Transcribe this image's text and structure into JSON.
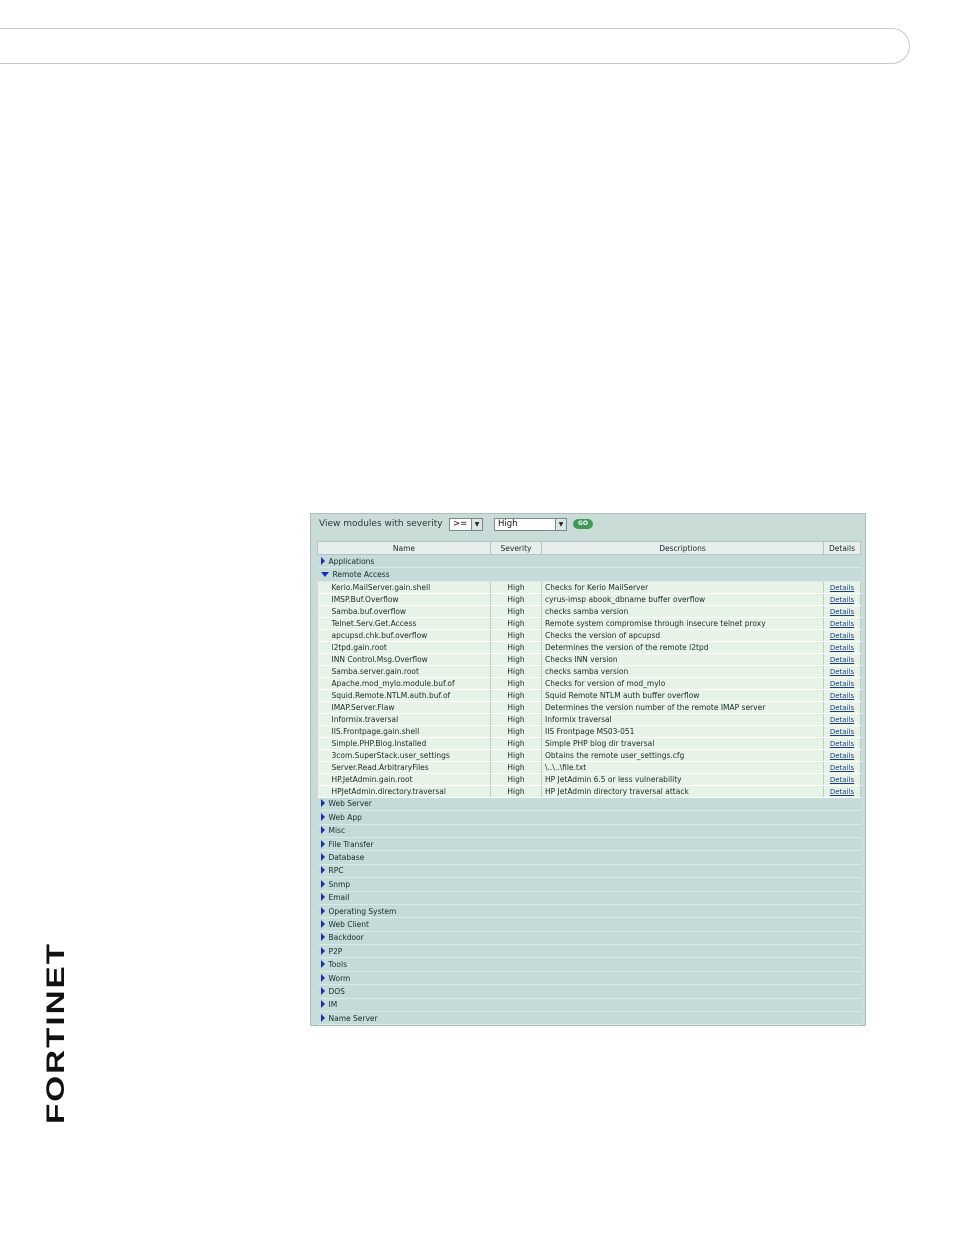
{
  "brand": {
    "logo_text": "FORTINET",
    "accent": "#d4202a"
  },
  "filter": {
    "label": "View modules with severity",
    "operator": ">=",
    "severity": "High",
    "go_label": "GO"
  },
  "table": {
    "headers": {
      "name": "Name",
      "severity": "Severity",
      "description": "Descriptions",
      "details": "Details"
    },
    "categories_before": [
      "Applications"
    ],
    "expanded_category": "Remote Access",
    "modules": [
      {
        "name": "Kerio.MailServer.gain.shell",
        "severity": "High",
        "description": "Checks for Kerio MailServer",
        "details": "Details"
      },
      {
        "name": "IMSP.Buf.Overflow",
        "severity": "High",
        "description": "cyrus-imsp abook_dbname buffer overflow",
        "details": "Details"
      },
      {
        "name": "Samba.buf.overflow",
        "severity": "High",
        "description": "checks samba version",
        "details": "Details"
      },
      {
        "name": "Telnet.Serv.Get.Access",
        "severity": "High",
        "description": "Remote system compromise through insecure telnet proxy",
        "details": "Details"
      },
      {
        "name": "apcupsd.chk.buf.overflow",
        "severity": "High",
        "description": "Checks the version of apcupsd",
        "details": "Details"
      },
      {
        "name": "l2tpd.gain.root",
        "severity": "High",
        "description": "Determines the version of the remote l2tpd",
        "details": "Details"
      },
      {
        "name": "INN Control.Msg.Overflow",
        "severity": "High",
        "description": "Checks INN version",
        "details": "Details"
      },
      {
        "name": "Samba.server.gain.root",
        "severity": "High",
        "description": "checks samba version",
        "details": "Details"
      },
      {
        "name": "Apache.mod_mylo.module.buf.of",
        "severity": "High",
        "description": "Checks for version of mod_mylo",
        "details": "Details"
      },
      {
        "name": "Squid.Remote.NTLM.auth.buf.of",
        "severity": "High",
        "description": "Squid Remote NTLM auth buffer overflow",
        "details": "Details"
      },
      {
        "name": "IMAP.Server.Flaw",
        "severity": "High",
        "description": "Determines the version number of the remote IMAP server",
        "details": "Details"
      },
      {
        "name": "Informix.traversal",
        "severity": "High",
        "description": "Informix traversal",
        "details": "Details"
      },
      {
        "name": "IIS.Frontpage.gain.shell",
        "severity": "High",
        "description": "IIS Frontpage MS03-051",
        "details": "Details"
      },
      {
        "name": "Simple.PHP.Blog.Installed",
        "severity": "High",
        "description": "Simple PHP blog dir traversal",
        "details": "Details"
      },
      {
        "name": "3com.SuperStack.user_settings",
        "severity": "High",
        "description": "Obtains the remote user_settings.cfg",
        "details": "Details"
      },
      {
        "name": "Server.Read.ArbitraryFiles",
        "severity": "High",
        "description": "\\..\\..\\file.txt",
        "details": "Details"
      },
      {
        "name": "HP.JetAdmin.gain.root",
        "severity": "High",
        "description": "HP JetAdmin 6.5 or less vulnerability",
        "details": "Details"
      },
      {
        "name": "HPJetAdmin.directory.traversal",
        "severity": "High",
        "description": "HP JetAdmin directory traversal attack",
        "details": "Details"
      }
    ],
    "categories_after": [
      "Web Server",
      "Web App",
      "Misc",
      "File Transfer",
      "Database",
      "RPC",
      "Snmp",
      "Email",
      "Operating System",
      "Web Client",
      "Backdoor",
      "P2P",
      "Tools",
      "Worm",
      "DOS",
      "IM",
      "Name Server"
    ]
  }
}
